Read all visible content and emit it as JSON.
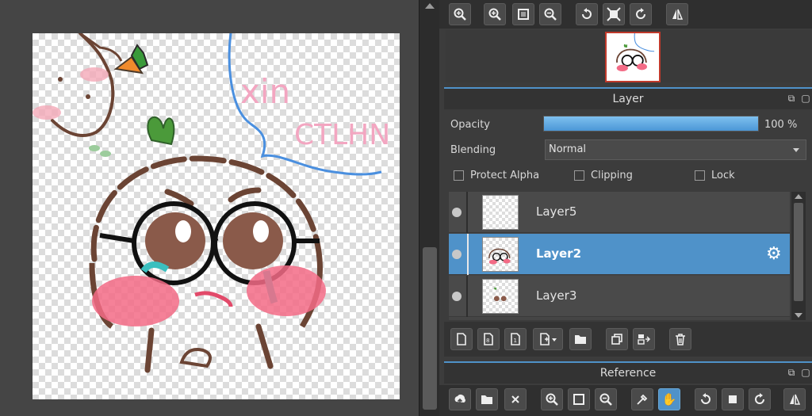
{
  "navigator": {
    "tools": [
      "zoom-fit",
      "zoom-in",
      "fit-screen",
      "zoom-out",
      "rotate-left",
      "reset",
      "rotate-right",
      "flip"
    ]
  },
  "layer_panel": {
    "title": "Layer",
    "opacity_label": "Opacity",
    "opacity_value": "100 %",
    "opacity_fraction": 1.0,
    "blending_label": "Blending",
    "blending_value": "Normal",
    "checkboxes": {
      "protect_alpha": "Protect Alpha",
      "clipping": "Clipping",
      "lock": "Lock"
    },
    "layers": [
      {
        "name": "Layer5",
        "selected": false
      },
      {
        "name": "Layer2",
        "selected": true
      },
      {
        "name": "Layer3",
        "selected": false
      }
    ]
  },
  "reference_panel": {
    "title": "Reference"
  },
  "artwork": {
    "text_line1": "xin",
    "text_line2": "CTLHN"
  },
  "colors": {
    "accent": "#4f92c9",
    "panel_bg": "#3c3c3c",
    "canvas_bg": "#454545"
  }
}
